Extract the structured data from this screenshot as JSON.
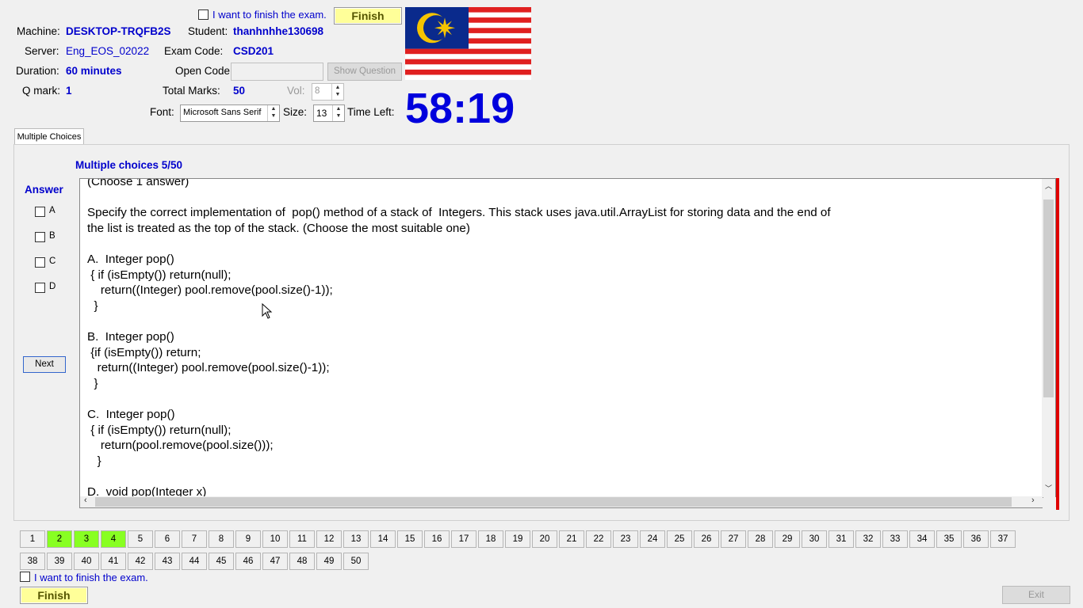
{
  "header": {
    "finish_checkbox_label": "I want to finish the exam.",
    "finish_button": "Finish",
    "machine_label": "Machine:",
    "machine_value": "DESKTOP-TRQFB2S",
    "student_label": "Student:",
    "student_value": "thanhnhhe130698",
    "server_label": "Server:",
    "server_value": "Eng_EOS_02022",
    "exam_code_label": "Exam Code:",
    "exam_code_value": "CSD201",
    "duration_label": "Duration:",
    "duration_value": "60 minutes",
    "open_code_label": "Open Code:",
    "open_code_value": "",
    "show_question_button": "Show Question",
    "q_mark_label": "Q mark:",
    "q_mark_value": "1",
    "total_marks_label": "Total Marks:",
    "total_marks_value": "50",
    "vol_label": "Vol:",
    "vol_value": "8",
    "font_label": "Font:",
    "font_value": "Microsoft Sans Serif",
    "size_label": "Size:",
    "size_value": "13",
    "time_left_label": "Time Left:",
    "time_left_value": "58:19"
  },
  "tab": {
    "label": "Multiple Choices"
  },
  "question": {
    "progress": "Multiple choices 5/50",
    "answer_heading": "Answer",
    "options": [
      "A",
      "B",
      "C",
      "D"
    ],
    "next_button": "Next",
    "text": "(Choose 1 answer)\n\nSpecify the correct implementation of  pop() method of a stack of  Integers. This stack uses java.util.ArrayList for storing data and the end of\nthe list is treated as the top of the stack. (Choose the most suitable one)\n\nA.  Integer pop()\n { if (isEmpty()) return(null);\n    return((Integer) pool.remove(pool.size()-1));\n  }\n\nB.  Integer pop()\n {if (isEmpty()) return;\n   return((Integer) pool.remove(pool.size()-1));\n  }\n\nC.  Integer pop()\n { if (isEmpty()) return(null);\n    return(pool.remove(pool.size()));\n   }\n\nD.  void pop(Integer x)"
  },
  "navigation": {
    "question_numbers": [
      "1",
      "2",
      "3",
      "4",
      "5",
      "6",
      "7",
      "8",
      "9",
      "10",
      "11",
      "12",
      "13",
      "14",
      "15",
      "16",
      "17",
      "18",
      "19",
      "20",
      "21",
      "22",
      "23",
      "24",
      "25",
      "26",
      "27",
      "28",
      "29",
      "30",
      "31",
      "32",
      "33",
      "34",
      "35",
      "36",
      "37",
      "38",
      "39",
      "40",
      "41",
      "42",
      "43",
      "44",
      "45",
      "46",
      "47",
      "48",
      "49",
      "50"
    ],
    "answered": [
      "2",
      "3",
      "4"
    ],
    "answered_color": "#88ff22"
  },
  "footer": {
    "finish_checkbox_label": "I want to finish the exam.",
    "finish_button": "Finish",
    "exit_button": "Exit"
  },
  "colors": {
    "accent_blue": "#0000cc",
    "timer_blue": "#0000dd",
    "finish_yellow": "#ffff99",
    "red_bar": "#e00000"
  },
  "flag": {
    "name": "malaysia-flag-icon"
  }
}
